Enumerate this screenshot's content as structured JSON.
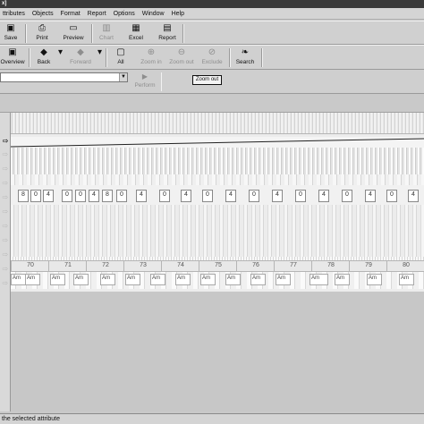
{
  "window": {
    "title_fragment": "x]"
  },
  "menu": [
    "ttributes",
    "Objects",
    "Format",
    "Report",
    "Options",
    "Window",
    "Help"
  ],
  "toolbar1": [
    {
      "label": "Save",
      "icon": "save-icon",
      "glyph": "▣",
      "disabled": false
    },
    {
      "label": "Print",
      "icon": "print-icon",
      "glyph": "⎙",
      "disabled": false
    },
    {
      "label": "Preview",
      "icon": "preview-icon",
      "glyph": "▭",
      "disabled": false
    },
    {
      "label": "Chart",
      "icon": "chart-icon",
      "glyph": "▥",
      "disabled": true
    },
    {
      "label": "Excel",
      "icon": "excel-icon",
      "glyph": "▦",
      "disabled": false
    },
    {
      "label": "Report",
      "icon": "report-icon",
      "glyph": "▤",
      "disabled": false
    }
  ],
  "toolbar2": [
    {
      "label": "Overview",
      "icon": "overview-icon",
      "glyph": "▣",
      "disabled": false
    },
    {
      "label": "Back",
      "icon": "back-arrow-icon",
      "glyph": "◆",
      "disabled": false
    },
    {
      "label": "Forward",
      "icon": "forward-arrow-icon",
      "glyph": "◆",
      "disabled": true
    },
    {
      "label": "All",
      "icon": "all-icon",
      "glyph": "▢",
      "disabled": false
    },
    {
      "label": "Zoom in",
      "icon": "zoom-in-icon",
      "glyph": "⊕",
      "disabled": true
    },
    {
      "label": "Zoom out",
      "icon": "zoom-out-icon",
      "glyph": "⊖",
      "disabled": true
    },
    {
      "label": "Exclude",
      "icon": "exclude-icon",
      "glyph": "⊘",
      "disabled": true
    },
    {
      "label": "Search",
      "icon": "search-icon",
      "glyph": "❧",
      "disabled": false
    }
  ],
  "toolbar3": {
    "perform_label": "Perform",
    "perform_icon": "play-icon",
    "perform_glyph": "▶"
  },
  "tooltip": "Zoom out",
  "grid": {
    "active_marker": "⇨",
    "inactive_marker": "⇨",
    "number_cells": [
      "8",
      "0",
      "4",
      "0",
      "0",
      "4",
      "8",
      "0",
      "4",
      "0",
      "4",
      "0",
      "4",
      "0",
      "4",
      "0",
      "4",
      "0",
      "4",
      "0",
      "4"
    ],
    "years": [
      "70",
      "71",
      "72",
      "73",
      "74",
      "75",
      "76",
      "77",
      "78",
      "79",
      "80"
    ],
    "names": [
      "Am",
      "Am",
      "Am",
      "Am",
      "Am",
      "Am",
      "Am",
      "Am",
      "Am",
      "Am",
      "Am",
      "Am",
      "Am",
      "Am",
      "Am",
      "Am"
    ]
  },
  "status": {
    "text": "the selected attribute"
  },
  "colors": {
    "accent": "#3a3a3a",
    "background": "#c8c8c8"
  }
}
